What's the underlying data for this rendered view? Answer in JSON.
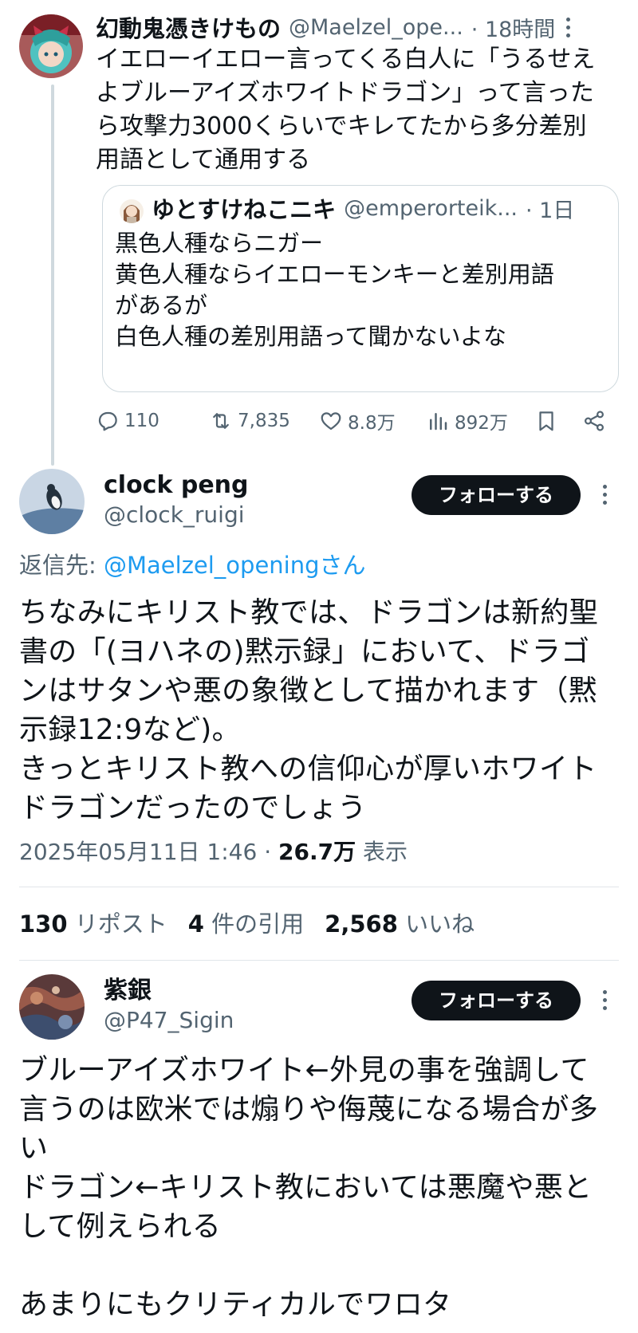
{
  "tweet1": {
    "display_name": "幻動鬼憑きけもの",
    "handle": "@Maelzel_ope...",
    "time": "· 18時間",
    "text": "イエローイエロー言ってくる白人に「うるせえ\nよブルーアイズホワイトドラゴン」って言った\nら攻撃力3000くらいでキレてたから多分差別\n用語として通用する",
    "quote": {
      "display_name": "ゆとすけねこニキ",
      "handle": "@emperorteik...",
      "time": "· 1日",
      "text": "黒色人種ならニガー\n黄色人種ならイエローモンキーと差別用語\nがあるが\n白色人種の差別用語って聞かないよな"
    },
    "actions": {
      "replies": "110",
      "reposts": "7,835",
      "likes": "8.8万",
      "views": "892万"
    }
  },
  "tweet2": {
    "display_name": "clock peng",
    "handle": "@clock_ruigi",
    "follow_label": "フォローする",
    "reply_to_prefix": "返信先: ",
    "reply_to_user": "@Maelzel_openingさん",
    "text": "ちなみにキリスト教では、ドラゴンは新約聖\n書の「(ヨハネの)黙示録」において、ドラゴ\nンはサタンや悪の象徴として描かれます（黙\n示録12:9など)。\nきっとキリスト教への信仰心が厚いホワイト\nドラゴンだったのでしょう",
    "date": "2025年05月11日 1:46 · ",
    "views_count": "26.7万",
    "views_label": " 表示",
    "stats": {
      "reposts_count": "130",
      "reposts_label": " リポスト",
      "quotes_count": "4",
      "quotes_label": " 件の引用",
      "likes_count": "2,568",
      "likes_label": " いいね"
    }
  },
  "tweet3": {
    "display_name": "紫銀",
    "handle": "@P47_Sigin",
    "follow_label": "フォローする",
    "text": "ブルーアイズホワイト←外見の事を強調して\n言うのは欧米では煽りや侮蔑になる場合が多\nい\nドラゴン←キリスト教においては悪魔や悪と\nして例えられる\n\nあまりにもクリティカルでワロタ"
  },
  "colors": {
    "text": "#0f1419",
    "muted": "#536471",
    "link": "#1d9bf0",
    "button_bg": "#0f1419",
    "border": "#cfd9de"
  }
}
